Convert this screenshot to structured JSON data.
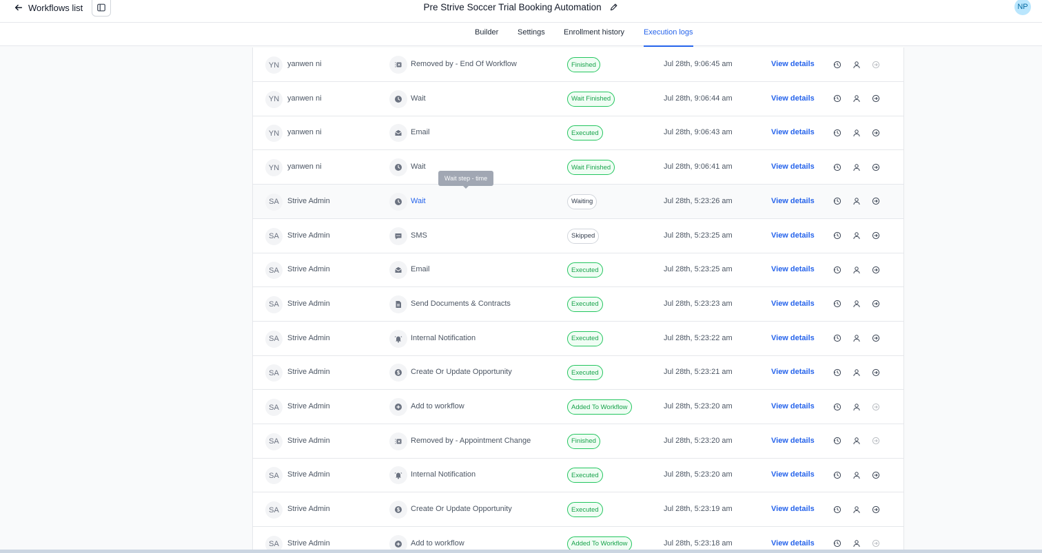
{
  "header": {
    "back_label": "Workflows list",
    "workflow_title": "Pre Strive Soccer Trial Booking Automation",
    "user_initials": "NP"
  },
  "tabs": [
    {
      "label": "Builder"
    },
    {
      "label": "Settings"
    },
    {
      "label": "Enrollment history"
    },
    {
      "label": "Execution logs",
      "active": true
    }
  ],
  "tooltip": {
    "text": "Wait step - time"
  },
  "colors": {
    "accent": "#2563eb",
    "success": "#16a34a"
  },
  "rows": [
    {
      "initials": "YN",
      "name": "yanwen ni",
      "icon": "removed-icon",
      "action": "Removed by - End Of Workflow",
      "status": "Finished",
      "status_type": "green",
      "time": "Jul 28th, 9:06:45 am",
      "link": "View details",
      "exit_dim": true
    },
    {
      "initials": "YN",
      "name": "yanwen ni",
      "icon": "clock-icon",
      "action": "Wait",
      "status": "Wait Finished",
      "status_type": "green",
      "time": "Jul 28th, 9:06:44 am",
      "link": "View details",
      "exit_dim": false
    },
    {
      "initials": "YN",
      "name": "yanwen ni",
      "icon": "email-icon",
      "action": "Email",
      "status": "Executed",
      "status_type": "green",
      "time": "Jul 28th, 9:06:43 am",
      "link": "View details",
      "exit_dim": false
    },
    {
      "initials": "YN",
      "name": "yanwen ni",
      "icon": "clock-icon",
      "action": "Wait",
      "status": "Wait Finished",
      "status_type": "green",
      "time": "Jul 28th, 9:06:41 am",
      "link": "View details",
      "exit_dim": false
    },
    {
      "initials": "SA",
      "name": "Strive Admin",
      "icon": "clock-icon",
      "action": "Wait",
      "action_link": true,
      "highlight": true,
      "status": "Waiting",
      "status_type": "gray",
      "time": "Jul 28th, 5:23:26 am",
      "link": "View details",
      "exit_dim": false
    },
    {
      "initials": "SA",
      "name": "Strive Admin",
      "icon": "sms-icon",
      "action": "SMS",
      "status": "Skipped",
      "status_type": "gray",
      "time": "Jul 28th, 5:23:25 am",
      "link": "View details",
      "exit_dim": false
    },
    {
      "initials": "SA",
      "name": "Strive Admin",
      "icon": "email-icon",
      "action": "Email",
      "status": "Executed",
      "status_type": "green",
      "time": "Jul 28th, 5:23:25 am",
      "link": "View details",
      "exit_dim": false
    },
    {
      "initials": "SA",
      "name": "Strive Admin",
      "icon": "document-icon",
      "action": "Send Documents & Contracts",
      "status": "Executed",
      "status_type": "green",
      "time": "Jul 28th, 5:23:23 am",
      "link": "View details",
      "exit_dim": false
    },
    {
      "initials": "SA",
      "name": "Strive Admin",
      "icon": "bell-icon",
      "action": "Internal Notification",
      "status": "Executed",
      "status_type": "green",
      "time": "Jul 28th, 5:23:22 am",
      "link": "View details",
      "exit_dim": false
    },
    {
      "initials": "SA",
      "name": "Strive Admin",
      "icon": "dollar-icon",
      "action": "Create Or Update Opportunity",
      "status": "Executed",
      "status_type": "green",
      "time": "Jul 28th, 5:23:21 am",
      "link": "View details",
      "exit_dim": false
    },
    {
      "initials": "SA",
      "name": "Strive Admin",
      "icon": "plus-circle-icon",
      "action": "Add to workflow",
      "status": "Added To Workflow",
      "status_type": "green",
      "time": "Jul 28th, 5:23:20 am",
      "link": "View details",
      "exit_dim": true
    },
    {
      "initials": "SA",
      "name": "Strive Admin",
      "icon": "removed-icon",
      "action": "Removed by - Appointment Change",
      "status": "Finished",
      "status_type": "green",
      "time": "Jul 28th, 5:23:20 am",
      "link": "View details",
      "exit_dim": true
    },
    {
      "initials": "SA",
      "name": "Strive Admin",
      "icon": "bell-icon",
      "action": "Internal Notification",
      "status": "Executed",
      "status_type": "green",
      "time": "Jul 28th, 5:23:20 am",
      "link": "View details",
      "exit_dim": false
    },
    {
      "initials": "SA",
      "name": "Strive Admin",
      "icon": "dollar-icon",
      "action": "Create Or Update Opportunity",
      "status": "Executed",
      "status_type": "green",
      "time": "Jul 28th, 5:23:19 am",
      "link": "View details",
      "exit_dim": false
    },
    {
      "initials": "SA",
      "name": "Strive Admin",
      "icon": "plus-circle-icon",
      "action": "Add to workflow",
      "status": "Added To Workflow",
      "status_type": "green",
      "time": "Jul 28th, 5:23:18 am",
      "link": "View details",
      "exit_dim": true
    }
  ]
}
